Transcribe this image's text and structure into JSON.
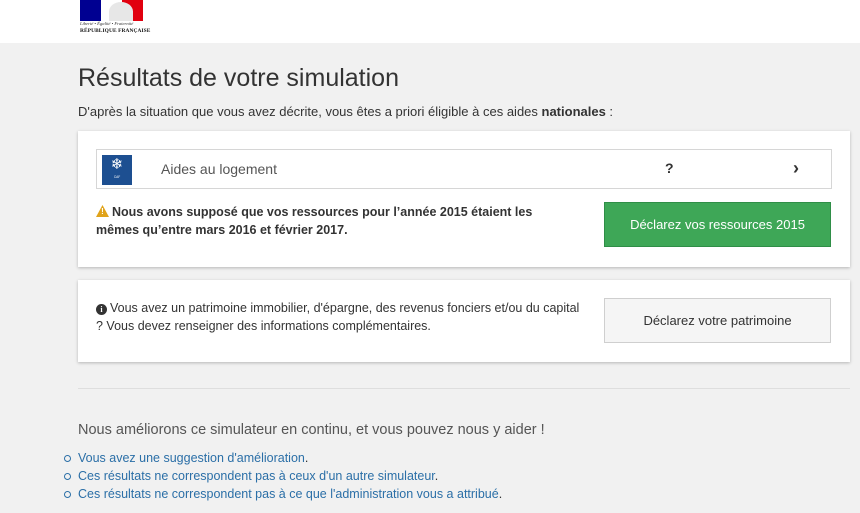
{
  "header": {
    "logo": {
      "motto": "Liberté • Égalité • Fraternité",
      "republic": "RÉPUBLIQUE FRANÇAISE"
    }
  },
  "page": {
    "title": "Résultats de votre simulation",
    "intro_prefix": "D'après la situation que vous avez décrite, vous êtes a priori éligible à ces aides ",
    "intro_bold": "nationales",
    "intro_suffix": " :"
  },
  "aides": [
    {
      "label": "Aides au logement",
      "amount": "?",
      "logo_text": "CAF",
      "icon": "caf-snowflake-icon"
    }
  ],
  "warning": {
    "icon": "warning-triangle-icon",
    "text": "Nous avons supposé que vos ressources pour l’année 2015 étaient les mêmes qu’entre mars 2016 et février 2017.",
    "button_label": "Déclarez vos ressources 2015",
    "button_color": "#3ea757"
  },
  "patrimoine": {
    "icon": "info-circle-icon",
    "text": "Vous avez un patrimoine immobilier, d'épargne, des revenus fonciers et/ou du capital ? Vous devez renseigner des informations complémentaires.",
    "button_label": "Déclarez votre patrimoine"
  },
  "feedback": {
    "heading": "Nous améliorons ce simulateur en continu, et vous pouvez nous y aider !",
    "links": [
      "Vous avez une suggestion d'amélioration",
      "Ces résultats ne correspondent pas à ceux d'un autre simulateur",
      "Ces résultats ne correspondent pas à ce que l'administration vous a attribué"
    ],
    "link_suffix": ".",
    "link_color": "#2b6fa7"
  }
}
